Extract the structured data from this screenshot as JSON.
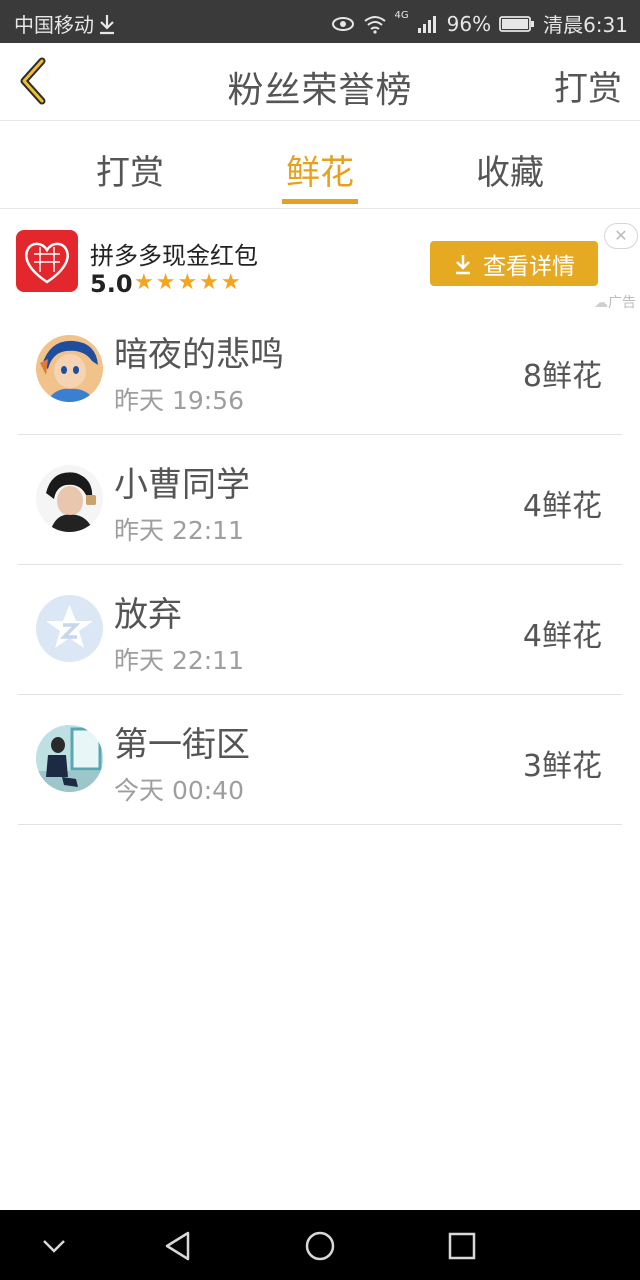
{
  "status_bar": {
    "carrier": "中国移动",
    "network": "4G",
    "battery": "96%",
    "time": "清晨6:31"
  },
  "header": {
    "title": "粉丝荣誉榜",
    "right_action": "打赏"
  },
  "tabs": [
    {
      "label": "打赏",
      "active": false
    },
    {
      "label": "鲜花",
      "active": true
    },
    {
      "label": "收藏",
      "active": false
    }
  ],
  "ad": {
    "name": "拼多多现金红包",
    "rating": "5.0",
    "stars": "★★★★★",
    "button_label": "查看详情",
    "label": "广告",
    "close": "✕"
  },
  "list": [
    {
      "name": "暗夜的悲鸣",
      "time": "昨天 19:56",
      "count": "8鲜花"
    },
    {
      "name": "小曹同学",
      "time": "昨天 22:11",
      "count": "4鲜花"
    },
    {
      "name": "放弃",
      "time": "昨天 22:11",
      "count": "4鲜花"
    },
    {
      "name": "第一街区",
      "time": "今天 00:40",
      "count": "3鲜花"
    }
  ],
  "colors": {
    "accent": "#e6a11f",
    "status_bar_bg": "#3a3a3a",
    "ad_button": "#e6a922",
    "logo_red": "#e4262d"
  }
}
